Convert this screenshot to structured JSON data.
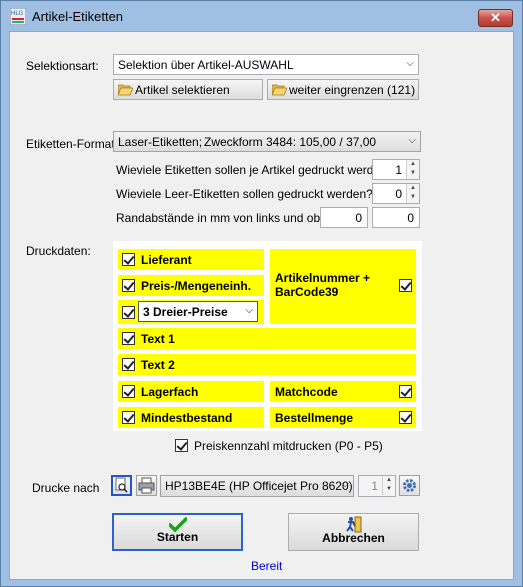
{
  "window": {
    "title": "Artikel-Etiketten",
    "app_icon_text": "HLG",
    "close_glyph": "✕"
  },
  "selection": {
    "label": "Selektionsart:",
    "value": "Selektion über Artikel-AUSWAHL",
    "btn_select": "Artikel selektieren",
    "btn_narrow": "weiter eingrenzen (121)"
  },
  "format": {
    "label": "Etiketten-Format:",
    "type": "Laser-Etiketten;",
    "form": "Zweckform 3484: 105,00 / 37,00"
  },
  "counts": {
    "per_article_label": "Wieviele Etiketten sollen je Artikel gedruckt werden?",
    "per_article_value": "1",
    "empty_label": "Wieviele Leer-Etiketten sollen gedruckt werden?",
    "empty_value": "0",
    "margin_label": "Randabstände in mm von links und oben:",
    "margin_left": "0",
    "margin_top": "0"
  },
  "print_data": {
    "label": "Druckdaten:",
    "lieferant": "Lieferant",
    "preis": "Preis-/Mengeneinh.",
    "preise_select": "3  Dreier-Preise",
    "artnr": "Artikelnummer +",
    "barcode": "BarCode39",
    "text1": "Text  1",
    "text2": "Text  2",
    "lagerfach": "Lagerfach",
    "matchcode": "Matchcode",
    "mindestbestand": "Mindestbestand",
    "bestellmenge": "Bestellmenge",
    "preiskennzahl": "Preiskennzahl mitdrucken  (P0 - P5)"
  },
  "output": {
    "label": "Drucke nach",
    "printer": "HP13BE4E (HP Officejet Pro 8620)",
    "copies": "1"
  },
  "buttons": {
    "start": "Starten",
    "cancel": "Abbrechen"
  },
  "status": "Bereit",
  "colors": {
    "highlight": "#ffff00",
    "status_text": "#0000cc"
  }
}
